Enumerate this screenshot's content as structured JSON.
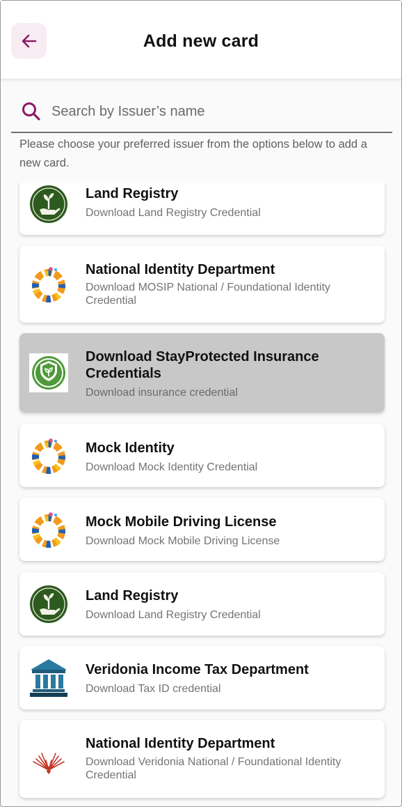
{
  "header": {
    "title": "Add new card"
  },
  "search": {
    "placeholder": "Search by Issuer’s name"
  },
  "hint": "Please choose your preferred issuer from the options below to add a new card.",
  "colors": {
    "accent": "#8b1a63",
    "selected_card": "#c8c8c8",
    "land_registry_green": "#2d5a1e",
    "bank_blue": "#1f5a78"
  },
  "issuers": [
    {
      "name": "Land Registry",
      "description": "Download Land Registry Credential",
      "icon": "land-registry-logo"
    },
    {
      "name": "National Identity Department",
      "description": "Download MOSIP National / Foundational Identity Credential",
      "icon": "mosip-ring-logo"
    },
    {
      "name": "Download StayProtected Insurance Credentials",
      "description": "Download insurance credential",
      "icon": "insurance-shield-logo",
      "selected": true
    },
    {
      "name": "Mock Identity",
      "description": "Download Mock Identity Credential",
      "icon": "mosip-ring-logo"
    },
    {
      "name": "Mock Mobile Driving License",
      "description": "Download Mock Mobile Driving License",
      "icon": "mosip-ring-logo"
    },
    {
      "name": "Land Registry",
      "description": "Download Land Registry Credential",
      "icon": "land-registry-logo"
    },
    {
      "name": "Veridonia Income Tax Department",
      "description": "Download Tax ID credential",
      "icon": "bank-building-logo"
    },
    {
      "name": "National Identity Department",
      "description": "Download Veridonia National / Foundational Identity Credential",
      "icon": "veridonia-wings-logo"
    }
  ]
}
